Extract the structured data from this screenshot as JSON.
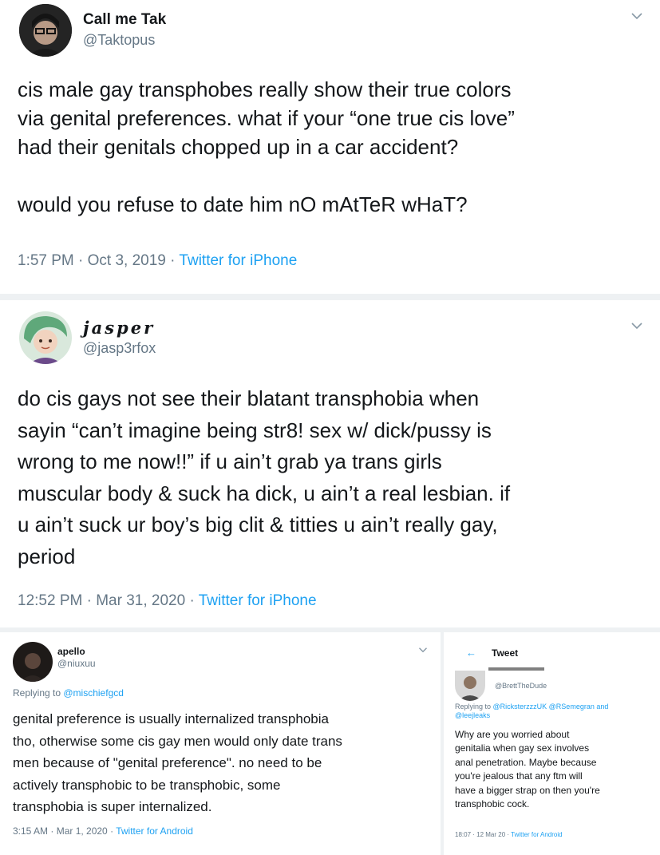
{
  "tweets": [
    {
      "name": "Call me Tak",
      "handle": "@Taktopus",
      "text_lines": [
        "cis male gay transphobes really show their true colors",
        "via genital preferences. what if your “one true cis love”",
        "had their genitals chopped up in a car accident?",
        "",
        "would you refuse to date him nO mAtTeR wHaT?"
      ],
      "time": "1:57 PM · Oct 3, 2019 · ",
      "source": "Twitter for iPhone"
    },
    {
      "name": "jasper",
      "handle": "@jasp3rfox",
      "text_lines": [
        "do cis gays not see their blatant transphobia when",
        "sayin “can’t imagine being str8! sex w/ dick/pussy is",
        "wrong to me now!!” if u ain’t grab ya trans girls",
        "muscular body & suck ha dick, u ain’t a real lesbian. if",
        "u ain’t suck ur boy’s big clit & titties u ain’t really gay,",
        "period"
      ],
      "time": "12:52 PM · Mar 31, 2020 · ",
      "source": "Twitter for iPhone"
    },
    {
      "name": "apello",
      "handle": "@niuxuu",
      "reply_prefix": "Replying to ",
      "reply_to": "@mischiefgcd",
      "text_lines": [
        "genital preference is usually internalized transphobia",
        "tho, otherwise some cis gay men would only date trans",
        "men because of \"genital preference\". no need to be",
        "actively transphobic to be transphobic, some",
        "transphobia is super internalized."
      ],
      "time": "3:15 AM · Mar 1, 2020 · ",
      "source": "Twitter for Android"
    },
    {
      "header_back": "←",
      "header_title": "Tweet",
      "handle": "@BrettTheDude",
      "reply_prefix": "Replying to ",
      "reply_to_line1": "@RicksterzzzUK @RSemegran and",
      "reply_to_line2": "@leejleaks",
      "text_lines": [
        "Why are you worried about",
        "genitalia when gay sex involves",
        "anal penetration. Maybe because",
        "you're jealous that any ftm will",
        "have a bigger strap on then you're",
        "transphobic cock."
      ],
      "time": "18:07 · 12 Mar 20 · ",
      "source": "Twitter for Android"
    }
  ],
  "icons": {
    "chevron": "chevron-down-icon",
    "back": "back-arrow-icon"
  },
  "colors": {
    "text": "#14171a",
    "secondary": "#657786",
    "link": "#1da1f2",
    "divider": "#e6ecf0"
  }
}
